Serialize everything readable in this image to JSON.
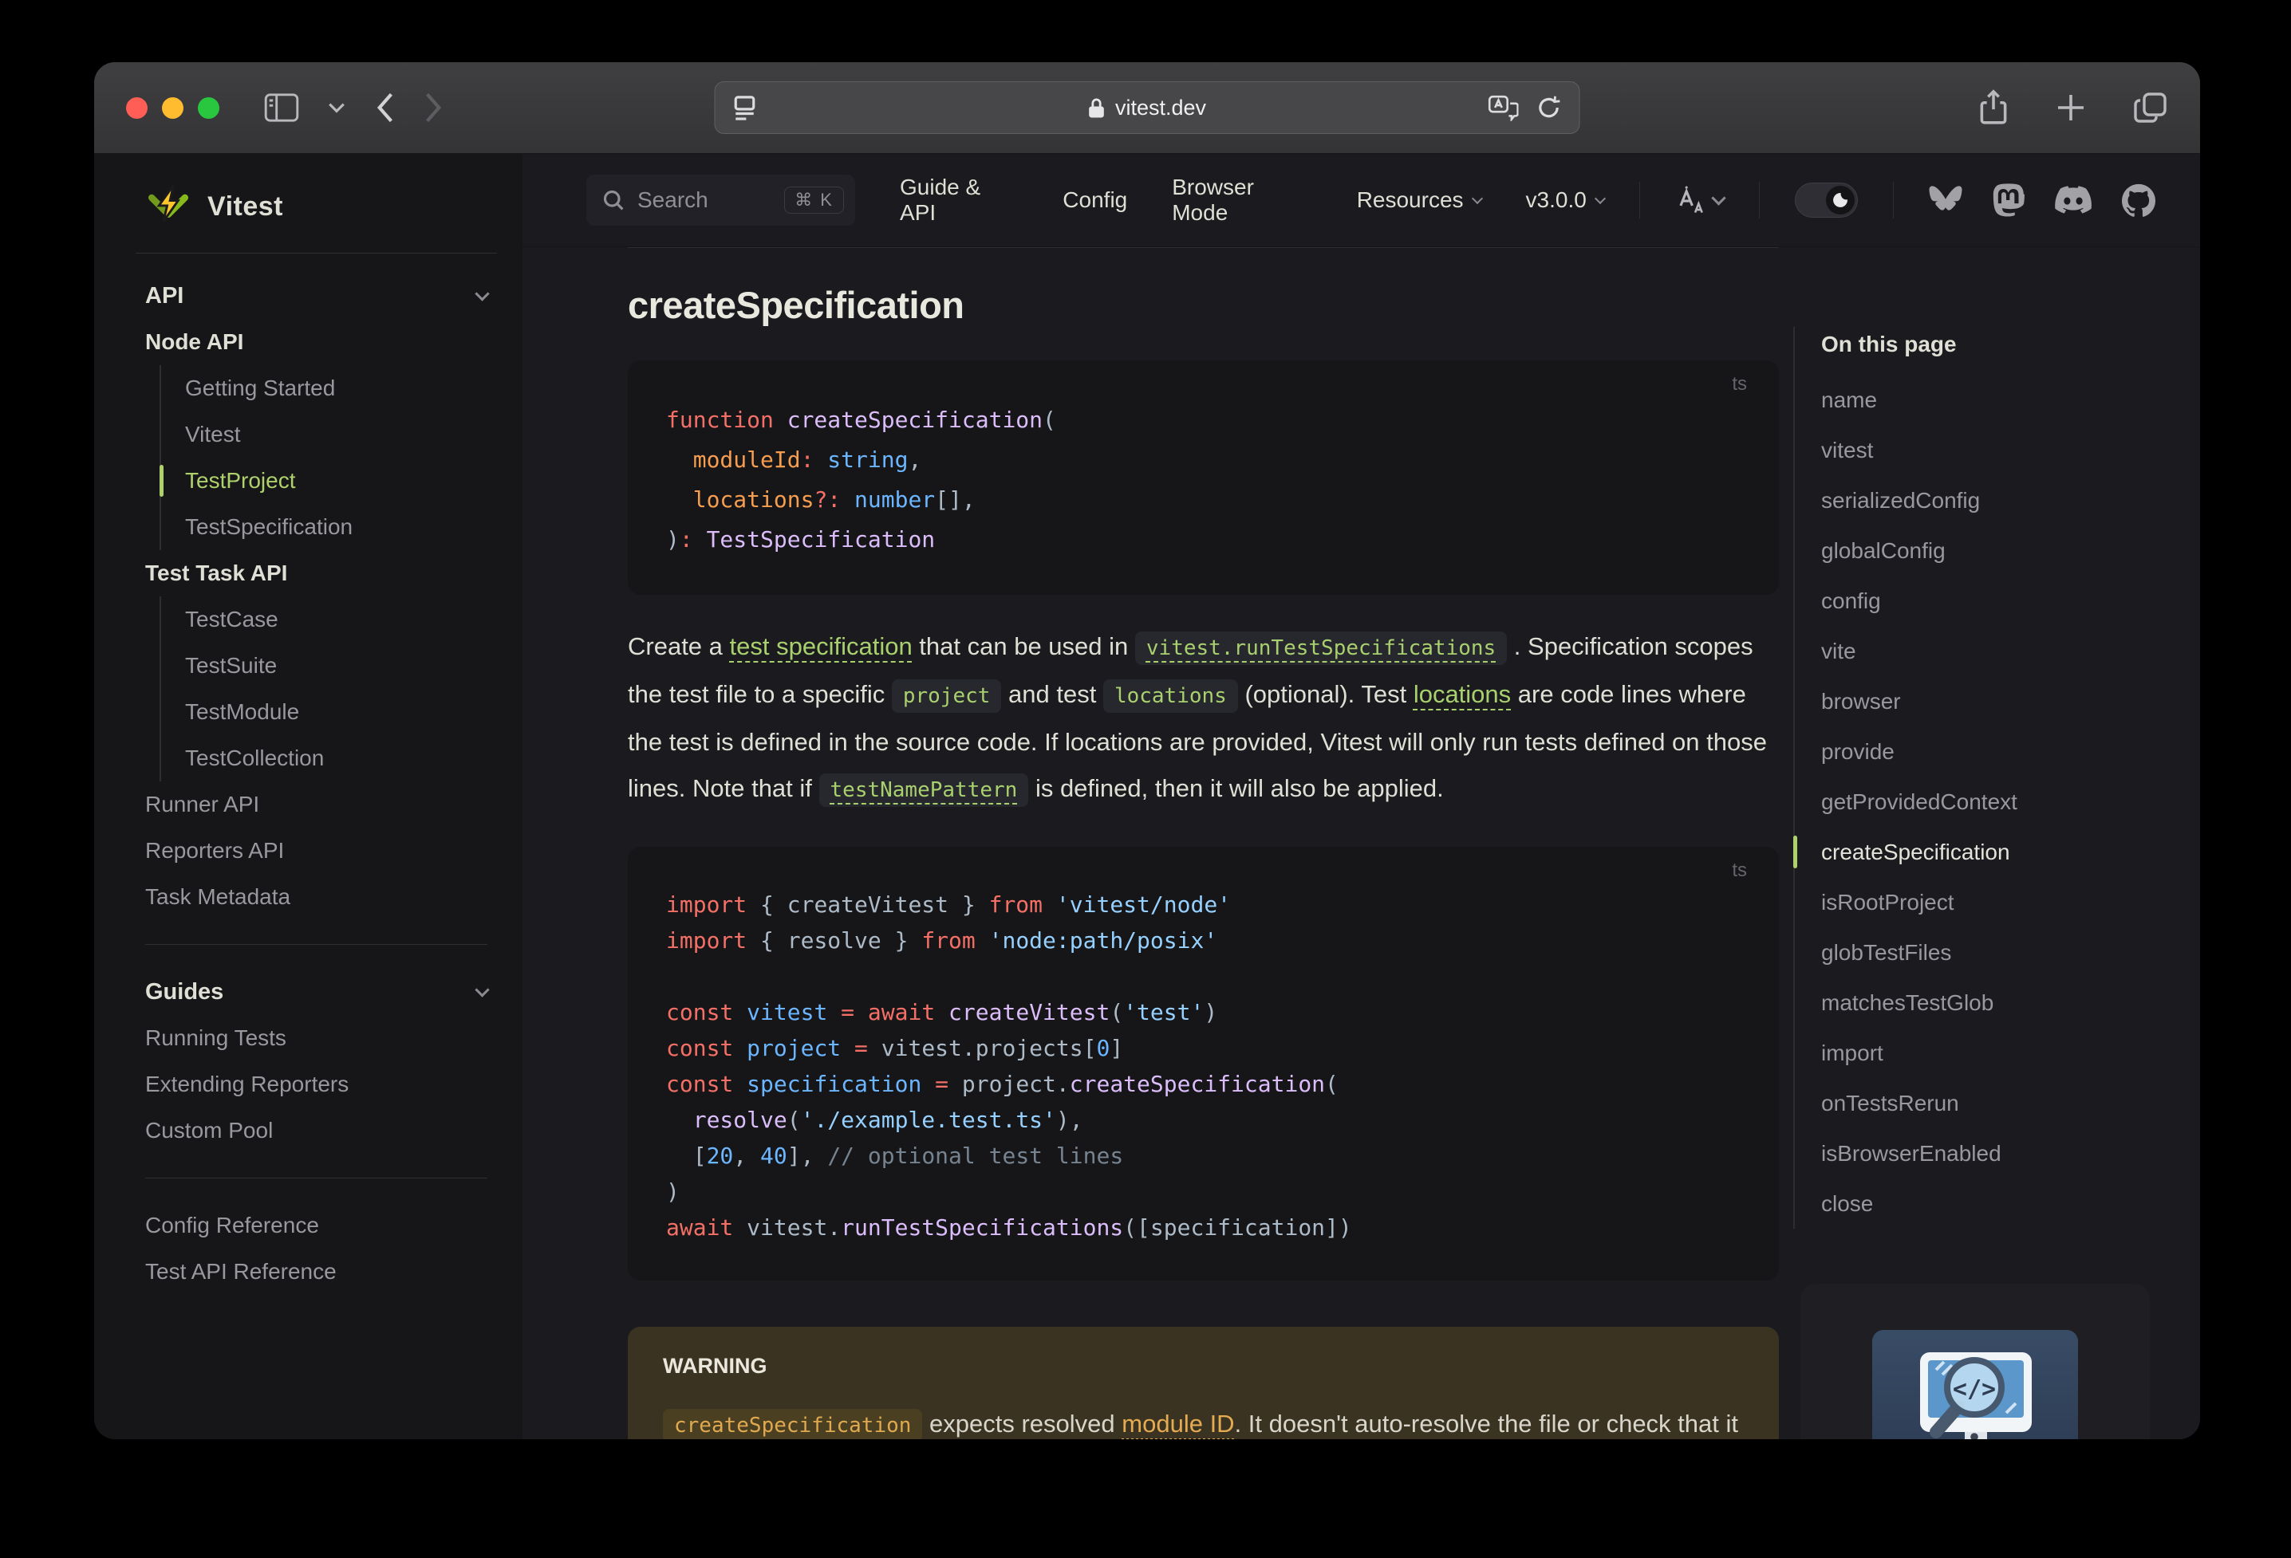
{
  "chrome": {
    "url": "vitest.dev",
    "traffic_lights": [
      "close",
      "minimize",
      "zoom"
    ]
  },
  "sidebar": {
    "logo_text": "Vitest",
    "groups": [
      {
        "title": "API",
        "chevron": true,
        "items": [
          {
            "label": "Node API",
            "kind": "section"
          },
          {
            "label": "Getting Started",
            "kind": "sub"
          },
          {
            "label": "Vitest",
            "kind": "sub"
          },
          {
            "label": "TestProject",
            "kind": "sub",
            "active": true
          },
          {
            "label": "TestSpecification",
            "kind": "sub"
          },
          {
            "label": "Test Task API",
            "kind": "section"
          },
          {
            "label": "TestCase",
            "kind": "sub"
          },
          {
            "label": "TestSuite",
            "kind": "sub"
          },
          {
            "label": "TestModule",
            "kind": "sub"
          },
          {
            "label": "TestCollection",
            "kind": "sub"
          },
          {
            "label": "Runner API",
            "kind": "item"
          },
          {
            "label": "Reporters API",
            "kind": "item"
          },
          {
            "label": "Task Metadata",
            "kind": "item"
          }
        ]
      },
      {
        "title": "Guides",
        "chevron": true,
        "items": [
          {
            "label": "Running Tests",
            "kind": "item"
          },
          {
            "label": "Extending Reporters",
            "kind": "item"
          },
          {
            "label": "Custom Pool",
            "kind": "item"
          }
        ]
      },
      {
        "title": null,
        "items": [
          {
            "label": "Config Reference",
            "kind": "item"
          },
          {
            "label": "Test API Reference",
            "kind": "item"
          }
        ]
      }
    ]
  },
  "navbar": {
    "search_label": "Search",
    "search_kbd": "⌘ K",
    "links": [
      {
        "label": "Guide & API",
        "chevron": false
      },
      {
        "label": "Config",
        "chevron": false
      },
      {
        "label": "Browser Mode",
        "chevron": false
      },
      {
        "label": "Resources",
        "chevron": true
      },
      {
        "label": "v3.0.0",
        "chevron": true
      }
    ],
    "social_links": [
      "Bluesky",
      "Mastodon",
      "Discord",
      "GitHub"
    ]
  },
  "doc": {
    "heading": "createSpecification",
    "code_block_1": {
      "lang": "ts",
      "lines": [
        [
          {
            "c": "k",
            "t": "function"
          },
          {
            "c": "p",
            "t": " "
          },
          {
            "c": "f",
            "t": "createSpecification"
          },
          {
            "c": "p",
            "t": "("
          }
        ],
        [
          {
            "c": "p",
            "t": "  "
          },
          {
            "c": "o",
            "t": "moduleId"
          },
          {
            "c": "k",
            "t": ":"
          },
          {
            "c": "p",
            "t": " "
          },
          {
            "c": "t",
            "t": "string"
          },
          {
            "c": "p",
            "t": ","
          }
        ],
        [
          {
            "c": "p",
            "t": "  "
          },
          {
            "c": "o",
            "t": "locations"
          },
          {
            "c": "k",
            "t": "?:"
          },
          {
            "c": "p",
            "t": " "
          },
          {
            "c": "t",
            "t": "number"
          },
          {
            "c": "p",
            "t": "[],"
          }
        ],
        [
          {
            "c": "p",
            "t": ")"
          },
          {
            "c": "k",
            "t": ":"
          },
          {
            "c": "p",
            "t": " "
          },
          {
            "c": "f",
            "t": "TestSpecification"
          }
        ]
      ]
    },
    "paragraph": [
      {
        "y": "t",
        "t": "Create a "
      },
      {
        "y": "l",
        "t": "test specification"
      },
      {
        "y": "t",
        "t": " that can be used in "
      },
      {
        "y": "cl",
        "t": "vitest.runTestSpecifications"
      },
      {
        "y": "t",
        "t": " . Specification scopes the test file to a specific "
      },
      {
        "y": "c",
        "t": "project"
      },
      {
        "y": "t",
        "t": " and test "
      },
      {
        "y": "c",
        "t": "locations"
      },
      {
        "y": "t",
        "t": " (optional). Test "
      },
      {
        "y": "l",
        "t": "locations"
      },
      {
        "y": "t",
        "t": " are code lines where the test is defined in the source code. If locations are provided, Vitest will only run tests defined on those lines. Note that if "
      },
      {
        "y": "cl",
        "t": "testNamePattern"
      },
      {
        "y": "t",
        "t": " is defined, then it will also be applied."
      }
    ],
    "code_block_2": {
      "lang": "ts",
      "lines": [
        [
          {
            "c": "k",
            "t": "import"
          },
          {
            "c": "p",
            "t": " { createVitest } "
          },
          {
            "c": "k",
            "t": "from"
          },
          {
            "c": "p",
            "t": " "
          },
          {
            "c": "s",
            "t": "'vitest/node'"
          }
        ],
        [
          {
            "c": "k",
            "t": "import"
          },
          {
            "c": "p",
            "t": " { resolve } "
          },
          {
            "c": "k",
            "t": "from"
          },
          {
            "c": "p",
            "t": " "
          },
          {
            "c": "s",
            "t": "'node:path/posix'"
          }
        ],
        [],
        [
          {
            "c": "k",
            "t": "const"
          },
          {
            "c": "p",
            "t": " "
          },
          {
            "c": "t",
            "t": "vitest"
          },
          {
            "c": "p",
            "t": " "
          },
          {
            "c": "k",
            "t": "="
          },
          {
            "c": "p",
            "t": " "
          },
          {
            "c": "k",
            "t": "await"
          },
          {
            "c": "p",
            "t": " "
          },
          {
            "c": "f",
            "t": "createVitest"
          },
          {
            "c": "p",
            "t": "("
          },
          {
            "c": "s",
            "t": "'test'"
          },
          {
            "c": "p",
            "t": ")"
          }
        ],
        [
          {
            "c": "k",
            "t": "const"
          },
          {
            "c": "p",
            "t": " "
          },
          {
            "c": "t",
            "t": "project"
          },
          {
            "c": "p",
            "t": " "
          },
          {
            "c": "k",
            "t": "="
          },
          {
            "c": "p",
            "t": " vitest.projects["
          },
          {
            "c": "t",
            "t": "0"
          },
          {
            "c": "p",
            "t": "]"
          }
        ],
        [
          {
            "c": "k",
            "t": "const"
          },
          {
            "c": "p",
            "t": " "
          },
          {
            "c": "t",
            "t": "specification"
          },
          {
            "c": "p",
            "t": " "
          },
          {
            "c": "k",
            "t": "="
          },
          {
            "c": "p",
            "t": " project."
          },
          {
            "c": "f",
            "t": "createSpecification"
          },
          {
            "c": "p",
            "t": "("
          }
        ],
        [
          {
            "c": "p",
            "t": "  "
          },
          {
            "c": "f",
            "t": "resolve"
          },
          {
            "c": "p",
            "t": "("
          },
          {
            "c": "s",
            "t": "'./example.test.ts'"
          },
          {
            "c": "p",
            "t": "),"
          }
        ],
        [
          {
            "c": "p",
            "t": "  ["
          },
          {
            "c": "t",
            "t": "20"
          },
          {
            "c": "p",
            "t": ", "
          },
          {
            "c": "t",
            "t": "40"
          },
          {
            "c": "p",
            "t": "], "
          },
          {
            "c": "c",
            "t": "// optional test lines"
          }
        ],
        [
          {
            "c": "p",
            "t": ")"
          }
        ],
        [
          {
            "c": "k",
            "t": "await"
          },
          {
            "c": "p",
            "t": " vitest."
          },
          {
            "c": "f",
            "t": "runTestSpecifications"
          },
          {
            "c": "p",
            "t": "([specification])"
          }
        ]
      ]
    },
    "warning": {
      "title": "WARNING",
      "body": [
        {
          "y": "wc",
          "t": "createSpecification"
        },
        {
          "y": "t",
          "t": " expects resolved "
        },
        {
          "y": "wl",
          "t": "module ID"
        },
        {
          "y": "t",
          "t": ". It doesn't auto-resolve the file or check that it exists on the file system."
        }
      ]
    }
  },
  "toc": {
    "title": "On this page",
    "items": [
      {
        "label": "name"
      },
      {
        "label": "vitest"
      },
      {
        "label": "serializedConfig"
      },
      {
        "label": "globalConfig"
      },
      {
        "label": "config"
      },
      {
        "label": "vite"
      },
      {
        "label": "browser"
      },
      {
        "label": "provide"
      },
      {
        "label": "getProvidedContext"
      },
      {
        "label": "createSpecification",
        "active": true
      },
      {
        "label": "isRootProject"
      },
      {
        "label": "globTestFiles"
      },
      {
        "label": "matchesTestGlob"
      },
      {
        "label": "import"
      },
      {
        "label": "onTestsRerun"
      },
      {
        "label": "isBrowserEnabled"
      },
      {
        "label": "close"
      }
    ]
  },
  "colors": {
    "brand_green": "#aed16b",
    "sidebar_bg": "#161618",
    "page_bg": "#1b1b1f",
    "code_bg": "#161618",
    "warning_bg": "#3b3321",
    "warning_accent": "#e0a94f"
  }
}
